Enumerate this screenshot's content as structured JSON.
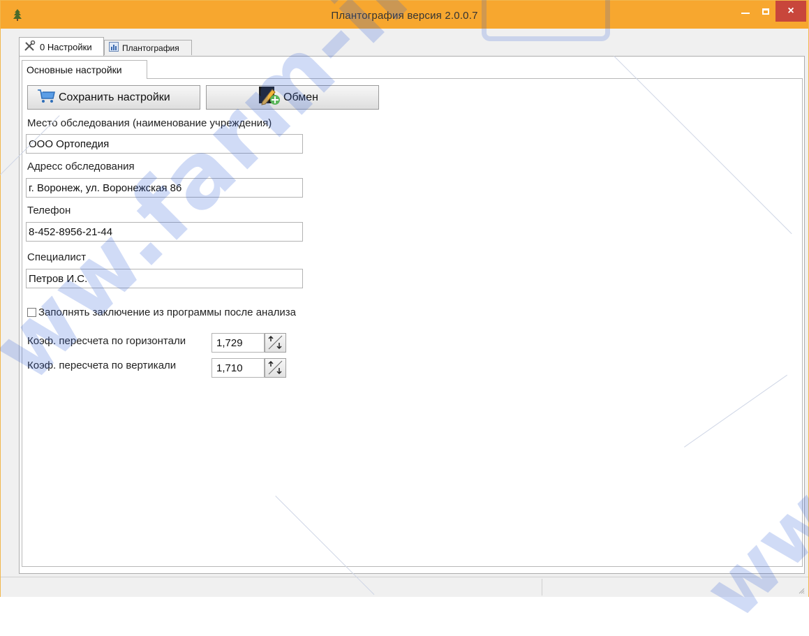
{
  "window": {
    "title": "Плантография версия 2.0.0.7",
    "close_glyph": "×"
  },
  "tabs": [
    {
      "label": "0 Настройки",
      "icon": "tools-icon",
      "active": true
    },
    {
      "label": "Плантография",
      "icon": "chart-icon",
      "active": false
    }
  ],
  "subtab": {
    "label": "Основные настройки"
  },
  "buttons": {
    "save_label": "Сохранить настройки",
    "exchange_label": "Обмен"
  },
  "form": {
    "place_label": "Место обследования (наименование учреждения)",
    "place_value": "ООО Ортопедия",
    "address_label": "Адресс обследования",
    "address_value": "г. Воронеж, ул. Воронежская 86",
    "phone_label": "Телефон",
    "phone_value": "8-452-8956-21-44",
    "specialist_label": "Специалист",
    "specialist_value": "Петров И.С.",
    "autofill_label": "Заполнять заключение из программы после анализа",
    "autofill_checked": false,
    "coef_h_label": "Коэф. пересчета по горизонтали",
    "coef_h_value": "1,729",
    "coef_v_label": "Коэф. пересчета по вертикали",
    "coef_v_value": "1,710"
  },
  "watermark": {
    "text": "ww.farm-invest.ru",
    "corner_text": "ww"
  },
  "colors": {
    "titlebar": "#f7a72f",
    "close_button": "#c8463b",
    "watermark": "#3060d8"
  }
}
